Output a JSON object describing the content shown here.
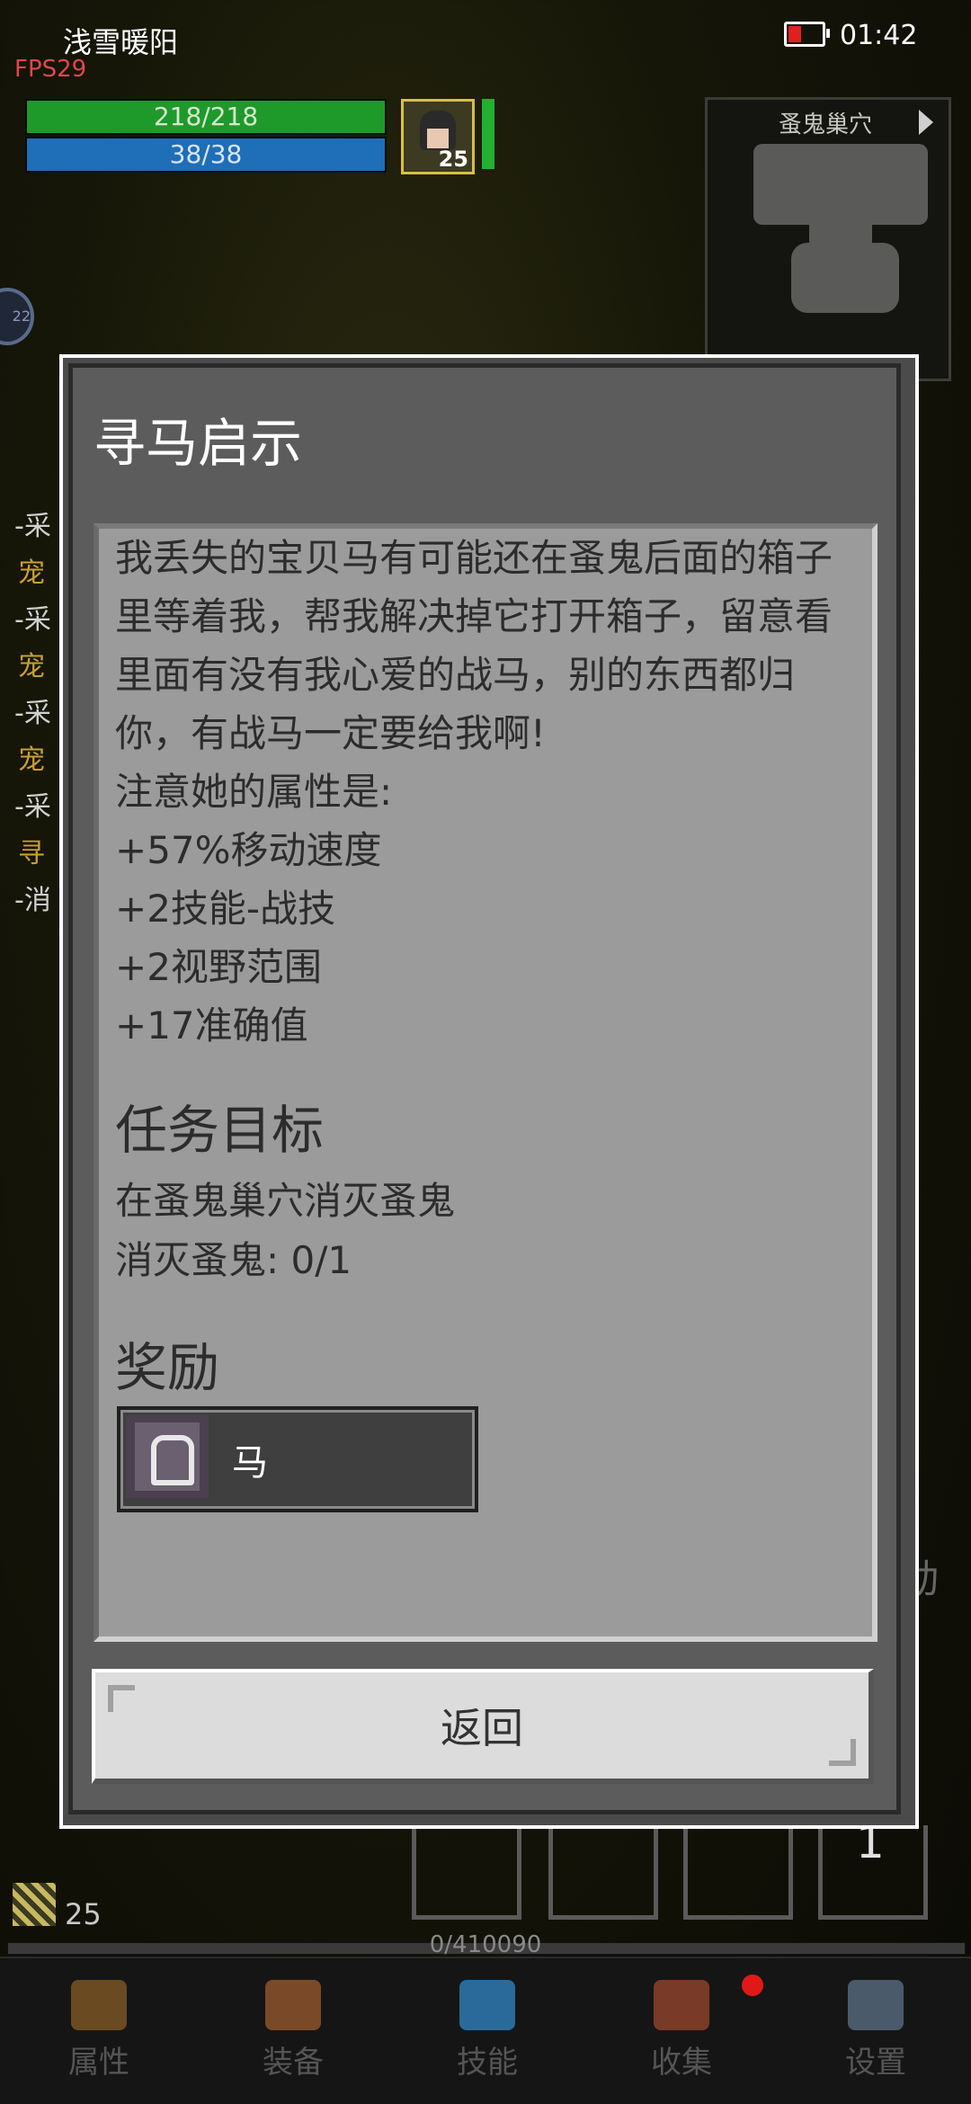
{
  "status": {
    "player_name": "浅雪暖阳",
    "fps": "FPS29",
    "time": "01:42"
  },
  "hud": {
    "hp": "218/218",
    "mp": "38/38",
    "player_level": "25",
    "minimap_title": "蚤鬼巢穴"
  },
  "side_quests": [
    {
      "text": "-采",
      "color": "#d0d0d0"
    },
    {
      "text": "宠",
      "color": "#c8a030"
    },
    {
      "text": "-采",
      "color": "#d0d0d0"
    },
    {
      "text": "宠",
      "color": "#c8a030"
    },
    {
      "text": "-采",
      "color": "#d0d0d0"
    },
    {
      "text": "宠",
      "color": "#c8a030"
    },
    {
      "text": "-采",
      "color": "#d0d0d0"
    },
    {
      "text": "寻",
      "color": "#c8a030"
    },
    {
      "text": "-消",
      "color": "#d0d0d0"
    }
  ],
  "dialog": {
    "title": "寻马启示",
    "description": "我丢失的宝贝马有可能还在蚤鬼后面的箱子里等着我，帮我解决掉它打开箱子，留意看里面有没有我心爱的战马，别的东西都归你，有战马一定要给我啊!\n注意她的属性是:\n+57%移动速度\n+2技能-战技\n+2视野范围\n+17准确值",
    "objective_title": "任务目标",
    "objective_lines": [
      "在蚤鬼巢穴消灭蚤鬼",
      "消灭蚤鬼: 0/1"
    ],
    "reward_title": "奖励",
    "reward_item": "马",
    "back_button": "返回"
  },
  "background": {
    "slot_number": "1",
    "side_char": "动"
  },
  "bottom": {
    "level": "25",
    "xp": "0/410090",
    "nav": [
      {
        "label": "属性",
        "icon": "helmet-icon",
        "color": "#6a4a20"
      },
      {
        "label": "装备",
        "icon": "bag-icon",
        "color": "#7a4a28"
      },
      {
        "label": "技能",
        "icon": "crystal-icon",
        "color": "#2a6a9a"
      },
      {
        "label": "收集",
        "icon": "book-icon",
        "color": "#7a3a28"
      },
      {
        "label": "设置",
        "icon": "gear-icon",
        "color": "#4a5a6a"
      }
    ]
  }
}
